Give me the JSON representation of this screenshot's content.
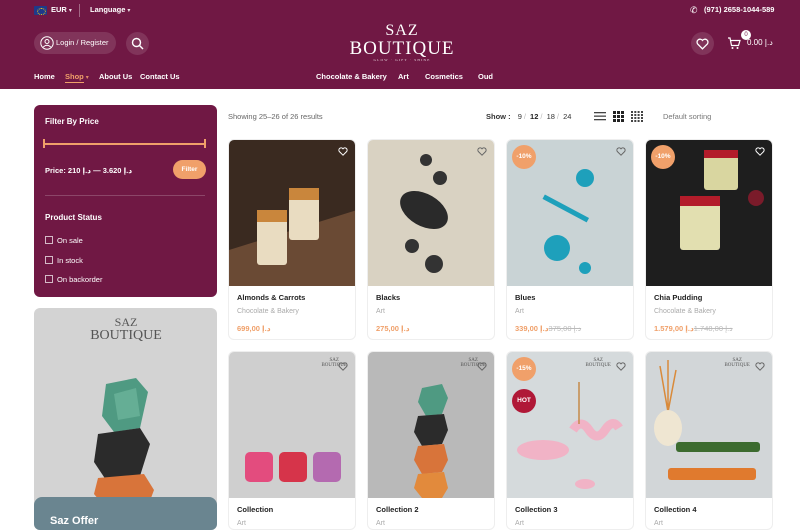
{
  "header": {
    "currency": "EUR",
    "language": "Language",
    "phone": "(971) 2658-1044-589",
    "login": "Login / Register",
    "logo_line1": "SAZ",
    "logo_line2": "BOUTIQUE",
    "logo_tagline": "GLOW · GIFT · SHINE",
    "cart_count": "0",
    "cart_total": "د.إ 0.00",
    "nav_left": [
      "Home",
      "Shop",
      "About Us",
      "Contact Us"
    ],
    "nav_center": [
      "Chocolate & Bakery",
      "Art",
      "Cosmetics",
      "Oud"
    ]
  },
  "sidebar": {
    "filter_title": "Filter By Price",
    "price_label": "Price: 210 د.إ 3.620 — د.إ",
    "filter_button": "Filter",
    "status_title": "Product Status",
    "status_options": [
      "On sale",
      "In stock",
      "On backorder"
    ],
    "promo_logo_line1": "SAZ",
    "promo_logo_line2": "BOUTIQUE",
    "promo_offer": "Saz Offer"
  },
  "toolbar": {
    "results": "Showing 25–26 of 26 results",
    "show_label": "Show :",
    "show_options": [
      "9",
      "12",
      "18",
      "24"
    ],
    "sort": "Default sorting"
  },
  "products": [
    {
      "name": "Almonds & Carrots",
      "category": "Chocolate & Bakery",
      "old_price": "",
      "price": "د.إ 699,00",
      "badge": ""
    },
    {
      "name": "Blacks",
      "category": "Art",
      "old_price": "",
      "price": "د.إ 275,00",
      "badge": ""
    },
    {
      "name": "Blues",
      "category": "Art",
      "old_price": "د.إ 375,00",
      "price": "د.إ 339,00",
      "badge": "-10%"
    },
    {
      "name": "Chia Pudding",
      "category": "Chocolate & Bakery",
      "old_price": "د.إ 1.748,00",
      "price": "د.إ 1.579,00",
      "badge": "-10%"
    },
    {
      "name": "Collection",
      "category": "Art",
      "old_price": "",
      "price": "",
      "badge": ""
    },
    {
      "name": "Collection 2",
      "category": "Art",
      "old_price": "",
      "price": "",
      "badge": ""
    },
    {
      "name": "Collection 3",
      "category": "Art",
      "old_price": "",
      "price": "",
      "badge": "-15%",
      "badge2": "HOT"
    },
    {
      "name": "Collection 4",
      "category": "Art",
      "old_price": "",
      "price": "",
      "badge": ""
    }
  ],
  "colors": {
    "brand": "#701844",
    "accent": "#f0a06a",
    "hot": "#b01837"
  }
}
